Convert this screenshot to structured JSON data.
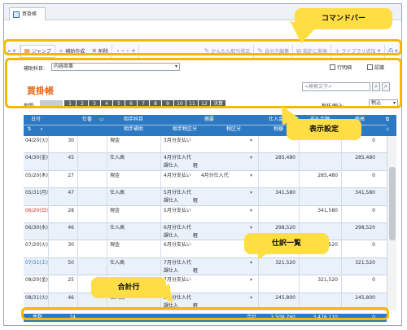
{
  "window": {
    "tab_title": "買掛帳"
  },
  "toolbar": {
    "jump_label": "ジャンプ",
    "add_label": "補助作成",
    "delete_label": "削除",
    "more_label": "・・・",
    "simple_label": "かんたん取引修正",
    "own_label": "自分方編集",
    "reorder_label": "指定に実換",
    "library_label": "ライブラリ追加"
  },
  "filter": {
    "sub_account_label": "補助科目:",
    "sub_account_value": "内容商事",
    "chk1": "行明細",
    "chk2": "認識",
    "title": "買掛帳",
    "search_placeholder": "<検索文字>",
    "period_label": "期間:",
    "months": [
      "1",
      "2",
      "3",
      "4",
      "5",
      "6",
      "7",
      "8",
      "9",
      "10",
      "11",
      "12",
      "決算"
    ],
    "tax_label": "税抜/税込:",
    "tax_value": "税込"
  },
  "grid": {
    "headers": {
      "date": "日付",
      "voucher": "仕番",
      "counter": "相手科目",
      "sub": "相手補助",
      "summary": "摘要",
      "tax_class": "相手税区分",
      "tax_kind": "税区分",
      "debit": "仕入金額",
      "debit_tax": "税額",
      "credit": "支払金額",
      "credit_tax": "税額",
      "balance": "残高"
    },
    "rows": [
      {
        "date": "04/20(火)",
        "no": "30",
        "acct": "現金",
        "memo1": "3月分支払い",
        "memo2": "",
        "debit": "",
        "credit": "",
        "bal": "0",
        "date_color": "#333"
      },
      {
        "date": "04/30(金)",
        "no": "45",
        "acct": "仕入高",
        "memo1": "4月分仕入代",
        "memo2": "課仕入　　　軽",
        "debit": "285,480",
        "credit": "",
        "bal": "285,480",
        "date_color": "#333"
      },
      {
        "date": "05/20(木)",
        "no": "27",
        "acct": "現金",
        "memo1": "4月分支払い　　4月分仕入代",
        "memo2": "",
        "debit": "",
        "credit": "285,480",
        "bal": "0",
        "date_color": "#333"
      },
      {
        "date": "05/31(月)",
        "no": "47",
        "acct": "仕入高",
        "memo1": "5月分仕入代",
        "memo2": "課仕入　　　軽",
        "debit": "341,580",
        "credit": "",
        "bal": "341,580",
        "date_color": "#333"
      },
      {
        "date": "06/20(日)",
        "no": "28",
        "acct": "現金",
        "memo1": "5月分支払い",
        "memo2": "",
        "debit": "",
        "credit": "341,580",
        "bal": "0",
        "date_color": "#d6281f"
      },
      {
        "date": "06/30(水)",
        "no": "46",
        "acct": "仕入高",
        "memo1": "6月分仕入代",
        "memo2": "課仕入　　　軽",
        "debit": "298,520",
        "credit": "",
        "bal": "298,520",
        "date_color": "#333"
      },
      {
        "date": "07/20(火)",
        "no": "30",
        "acct": "現金",
        "memo1": "6月分支払い",
        "memo2": "",
        "debit": "",
        "credit": "298,520",
        "bal": "0",
        "date_color": "#333"
      },
      {
        "date": "07/31(土)",
        "no": "50",
        "acct": "仕入高",
        "memo1": "7月分仕入代",
        "memo2": "課仕入　　　軽",
        "debit": "321,520",
        "credit": "",
        "bal": "321,520",
        "date_color": "#2c79c3"
      },
      {
        "date": "08/20(金)",
        "no": "25",
        "acct": "現金",
        "memo1": "7月分支払い",
        "memo2": "",
        "debit": "",
        "credit": "321,520",
        "bal": "0",
        "date_color": "#333"
      },
      {
        "date": "08/31(火)",
        "no": "46",
        "acct": "仕入高",
        "memo1": "8月分仕入代",
        "memo2": "課仕入　　　軽",
        "debit": "245,800",
        "credit": "",
        "bal": "245,800",
        "date_color": "#333"
      }
    ],
    "total": {
      "label": "件数",
      "count": "24",
      "sum_label": "合計",
      "debit": "3,508,760",
      "credit": "3,476,110",
      "bal": "0"
    }
  },
  "callouts": {
    "command_bar": "コマンドバー",
    "display_settings": "表示設定",
    "journal_list": "仕訳一覧",
    "total_row": "合計行"
  },
  "colors": {
    "accent": "#2c79c3",
    "highlight": "#f5b800",
    "title": "#e06a1a"
  }
}
